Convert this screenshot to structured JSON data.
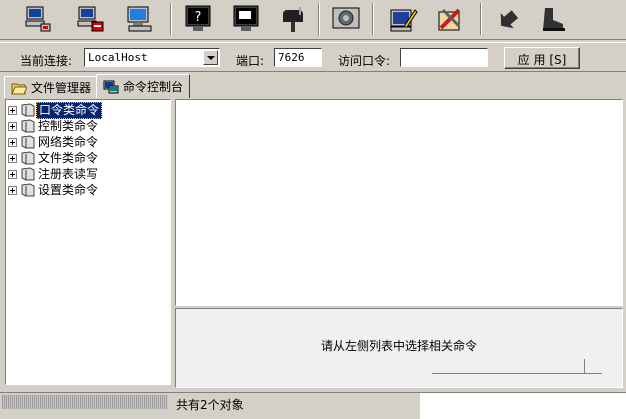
{
  "toolbar": {
    "buttons": [
      {
        "icon": "computer-connect-icon"
      },
      {
        "icon": "computer-disconnect-icon"
      },
      {
        "icon": "screen-monitor-icon"
      },
      {
        "icon": "help-monitor-icon"
      },
      {
        "icon": "window-monitor-icon"
      },
      {
        "icon": "mailbox-icon"
      },
      {
        "icon": "settings-gear-icon"
      },
      {
        "icon": "edit-pen-icon"
      },
      {
        "icon": "tools-icon"
      },
      {
        "icon": "back-arrow-icon"
      },
      {
        "icon": "boot-exit-icon"
      }
    ]
  },
  "connection": {
    "current_label": "当前连接:",
    "current_value": "LocalHost",
    "port_label": "端口:",
    "port_value": "7626",
    "password_label": "访问口令:",
    "password_value": "",
    "apply_label": "应 用 [S]"
  },
  "tabs": [
    {
      "label": "文件管理器",
      "icon": "folder-open-icon",
      "active": false
    },
    {
      "label": "命令控制台",
      "icon": "console-icon",
      "active": true
    }
  ],
  "tree": {
    "items": [
      {
        "label": "口令类命令",
        "selected": true
      },
      {
        "label": "控制类命令",
        "selected": false
      },
      {
        "label": "网络类命令",
        "selected": false
      },
      {
        "label": "文件类命令",
        "selected": false
      },
      {
        "label": "注册表读写",
        "selected": false
      },
      {
        "label": "设置类命令",
        "selected": false
      }
    ]
  },
  "hint": {
    "text": "请从左侧列表中选择相关命令"
  },
  "status": {
    "text": "共有2个对象"
  },
  "colors": {
    "face": "#d4d0c8",
    "selection": "#0a246a",
    "shadow": "#808080"
  }
}
